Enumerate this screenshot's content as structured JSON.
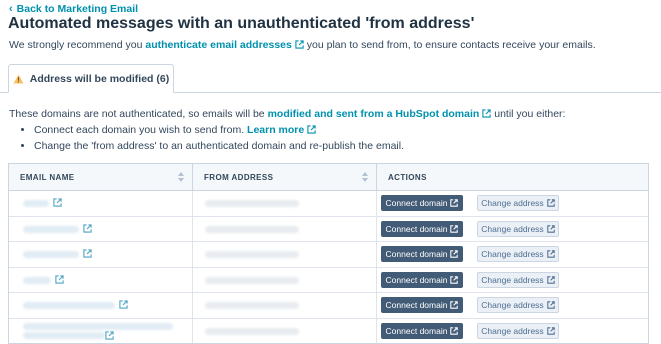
{
  "nav": {
    "back_label": "Back to Marketing Email"
  },
  "page": {
    "title": "Automated messages with an unauthenticated 'from address'"
  },
  "intro": {
    "prefix": "We strongly recommend you ",
    "link_text": "authenticate email addresses",
    "suffix": " you plan to send from, to ensure contacts receive your emails."
  },
  "tab": {
    "label": "Address will be modified (6)"
  },
  "description": {
    "prefix": "These domains are not authenticated, so emails will be ",
    "link_text": "modified and sent from a HubSpot domain",
    "suffix": " until you either:"
  },
  "bullets": {
    "item1_text": "Connect each domain you wish to send from. ",
    "item1_link": "Learn more",
    "item2_text": "Change the 'from address' to an authenticated domain and re-publish the email."
  },
  "table": {
    "columns": [
      "EMAIL NAME",
      "FROM ADDRESS",
      "ACTIONS"
    ],
    "rows": [
      {
        "connect_label": "Connect domain",
        "change_label": "Change address"
      },
      {
        "connect_label": "Connect domain",
        "change_label": "Change address"
      },
      {
        "connect_label": "Connect domain",
        "change_label": "Change address"
      },
      {
        "connect_label": "Connect domain",
        "change_label": "Change address"
      },
      {
        "connect_label": "Connect domain",
        "change_label": "Change address"
      },
      {
        "connect_label": "Connect domain",
        "change_label": "Change address"
      }
    ]
  },
  "colors": {
    "link": "#0091ae",
    "primary_button": "#425b76",
    "secondary_button": "#eaf0f6",
    "warning": "#f5c26b"
  },
  "icons": [
    "chevron-left-icon",
    "external-link-icon",
    "warning-icon",
    "sort-icon"
  ]
}
